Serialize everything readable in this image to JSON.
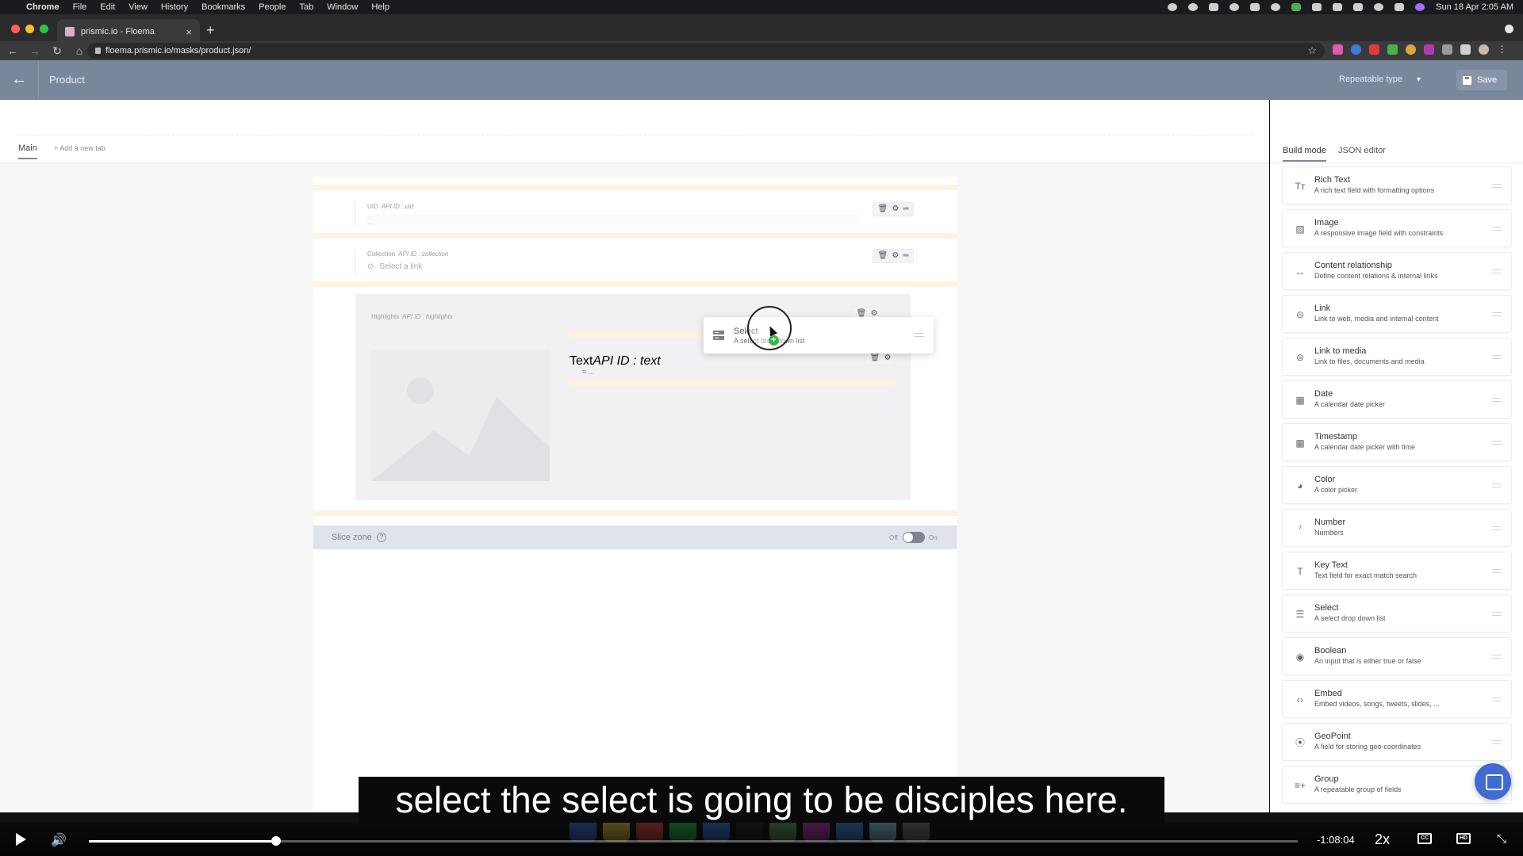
{
  "os_menu": {
    "app": "Chrome",
    "items": [
      "File",
      "Edit",
      "View",
      "History",
      "Bookmarks",
      "People",
      "Tab",
      "Window",
      "Help"
    ],
    "clock": "Sun 18 Apr  2:05 AM"
  },
  "browser": {
    "tab_title": "prismic.io - Floema",
    "url": "floema.prismic.io/masks/product.json/"
  },
  "header": {
    "title": "Product",
    "type_select": "Repeatable type",
    "save_label": "Save"
  },
  "editor": {
    "tabs": {
      "main": "Main",
      "add": "+ Add a new tab"
    },
    "fields": {
      "uid": {
        "name": "UID",
        "api": "API ID : uid",
        "value": "..."
      },
      "collection": {
        "name": "Collection",
        "api": "API ID : collection",
        "placeholder": "Select a link"
      },
      "highlights": {
        "name": "Highlights",
        "api": "API ID : highlights"
      },
      "text": {
        "name": "Text",
        "api": "API ID : text",
        "value": "..."
      }
    },
    "slice_zone": {
      "label": "Slice zone",
      "help": "?",
      "off": "Off",
      "on": "On",
      "enabled": false
    }
  },
  "drag_card": {
    "name": "Select",
    "desc": "A select drop down list"
  },
  "panel": {
    "tabs": {
      "build": "Build mode",
      "json": "JSON editor"
    },
    "widgets": [
      {
        "icon": "rich-text",
        "glyph": "Tт",
        "name": "Rich Text",
        "desc": "A rich text field with formatting options"
      },
      {
        "icon": "image",
        "glyph": "▨",
        "name": "Image",
        "desc": "A responsive image field with constraints"
      },
      {
        "icon": "content-relationship",
        "glyph": "↔",
        "name": "Content relationship",
        "desc": "Define content relations & internal links"
      },
      {
        "icon": "link",
        "glyph": "⊝",
        "name": "Link",
        "desc": "Link to web, media and internal content"
      },
      {
        "icon": "link-to-media",
        "glyph": "⊜",
        "name": "Link to media",
        "desc": "Link to files, documents and media"
      },
      {
        "icon": "date",
        "glyph": "▦",
        "name": "Date",
        "desc": "A calendar date picker"
      },
      {
        "icon": "timestamp",
        "glyph": "▦",
        "name": "Timestamp",
        "desc": "A calendar date picker with time"
      },
      {
        "icon": "color",
        "glyph": "◕",
        "name": "Color",
        "desc": "A color picker"
      },
      {
        "icon": "number",
        "glyph": "⁷",
        "name": "Number",
        "desc": "Numbers"
      },
      {
        "icon": "key-text",
        "glyph": "T",
        "name": "Key Text",
        "desc": "Text field for exact match search"
      },
      {
        "icon": "select",
        "glyph": "☰",
        "name": "Select",
        "desc": "A select drop down list"
      },
      {
        "icon": "boolean",
        "glyph": "◉",
        "name": "Boolean",
        "desc": "An input that is either true or false"
      },
      {
        "icon": "embed",
        "glyph": "‹›",
        "name": "Embed",
        "desc": "Embed videos, songs, tweets, slides, ..."
      },
      {
        "icon": "geopoint",
        "glyph": "⦿",
        "name": "GeoPoint",
        "desc": "A field for storing geo-coordinates"
      },
      {
        "icon": "group",
        "glyph": "≡+",
        "name": "Group",
        "desc": "A repeatable group of fields"
      }
    ]
  },
  "video": {
    "caption": "select the select is going to be disciples here.",
    "time_remaining": "-1:08:04",
    "speed": "2x",
    "progress": 0.155
  }
}
